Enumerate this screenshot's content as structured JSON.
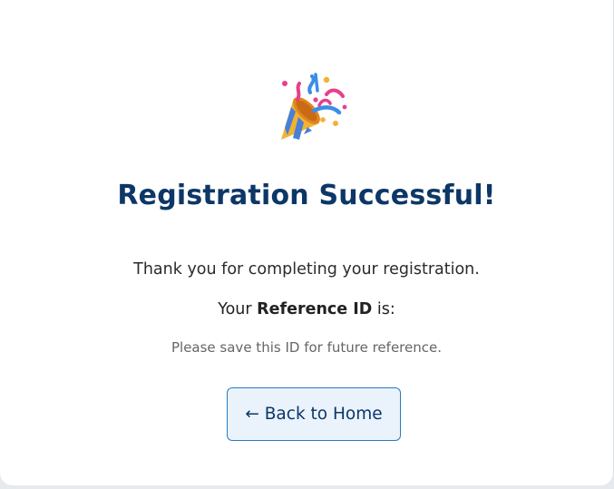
{
  "success": {
    "icon": "party-popper-icon",
    "title": "Registration Successful!",
    "message": "Thank you for completing your registration.",
    "reference_prefix": "Your",
    "reference_label": "Reference ID",
    "reference_suffix": "is:",
    "note": "Please save this ID for future reference.",
    "back_button_label": "← Back to Home"
  },
  "colors": {
    "title": "#0c3766",
    "button_border": "#2a7ac0",
    "button_bg": "#eaf3fc"
  }
}
